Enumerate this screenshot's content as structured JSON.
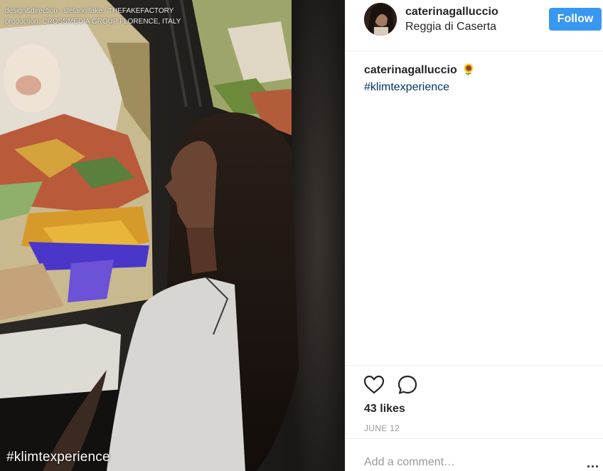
{
  "photo": {
    "credits_line1": "design&direction : stefano fake / THEFAKEFACTORY",
    "credits_line2": "production: CROSSMEDIA GROUP FLORENCE, ITALY",
    "overlay_hashtag": "#klimtexperience"
  },
  "header": {
    "username": "caterinagalluccio",
    "location": "Reggia di Caserta",
    "follow_label": "Follow"
  },
  "caption": {
    "username": "caterinagalluccio",
    "emoji": "🌻",
    "hashtag": "#klimtexperience"
  },
  "actions": {
    "like_icon": "heart-icon",
    "comment_icon": "speech-bubble-icon",
    "likes_text": "43 likes",
    "date": "JUNE 12"
  },
  "comment": {
    "placeholder": "Add a comment…",
    "more_label": "..."
  },
  "colors": {
    "follow_button": "#3897f0",
    "hashtag_link": "#003569",
    "muted_text": "#999999",
    "primary_text": "#262626"
  }
}
